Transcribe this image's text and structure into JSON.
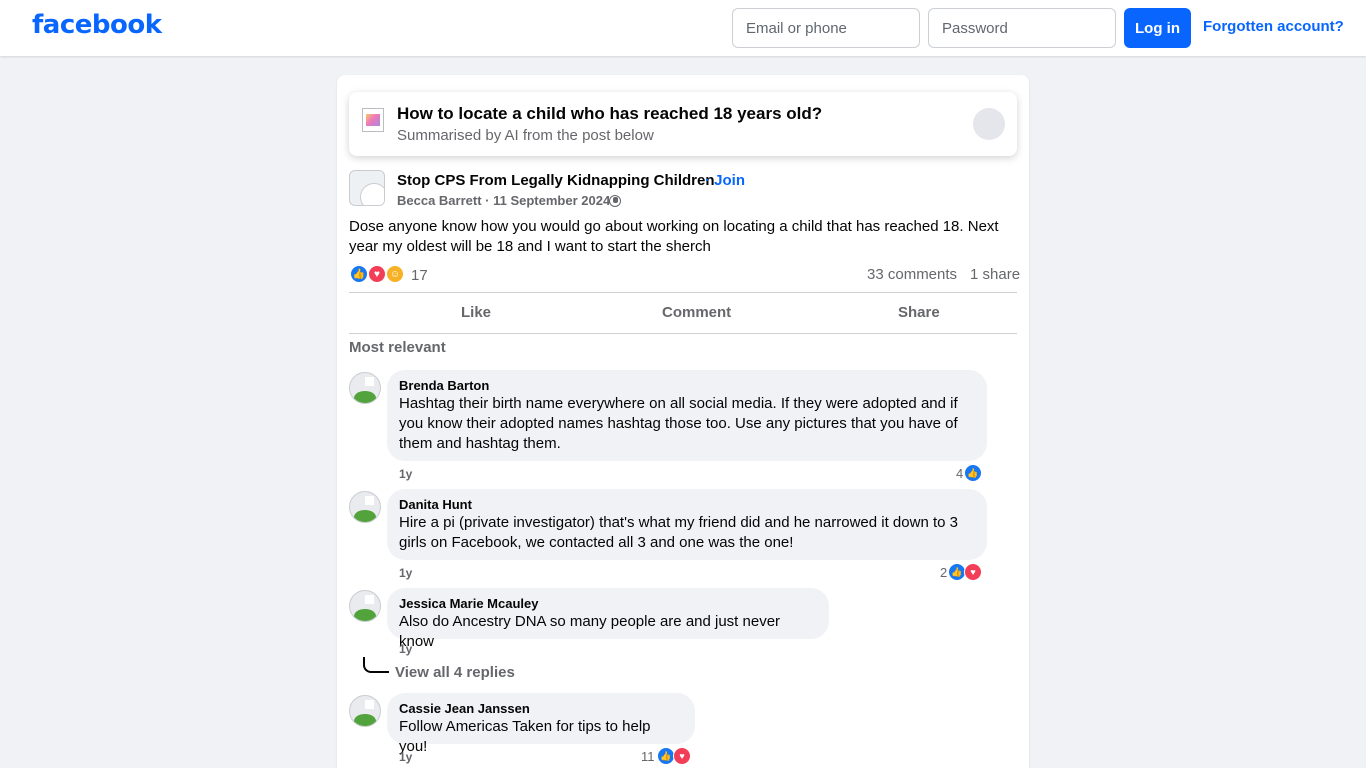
{
  "header": {
    "logo": "facebook",
    "email_placeholder": "Email or phone",
    "password_placeholder": "Password",
    "login_label": "Log in",
    "forgot_label": "Forgotten account?"
  },
  "ai_summary": {
    "title": "How to locate a child who has reached 18 years old?",
    "subtitle": "Summarised by AI from the post below"
  },
  "post": {
    "group_name": "Stop CPS From Legally Kidnapping Children",
    "join_label": "· Join",
    "author_date": "Becca Barrett · 11 September 2024 ·",
    "text": "Dose anyone know how you would go about working on locating a child that has reached 18. Next year my oldest will be 18 and I want to start the sherch",
    "reactions_count": "17",
    "comments_count": "33 comments",
    "shares_count": "1 share",
    "actions": {
      "like": "Like",
      "comment": "Comment",
      "share": "Share"
    },
    "sort_label": "Most relevant"
  },
  "comments": [
    {
      "name": "Brenda Barton",
      "text": "Hashtag their birth name everywhere on all social media. If they were adopted and if you know their adopted names hashtag those too. Use any pictures that you have of them and hashtag them.",
      "time": "1y",
      "reactions": "4"
    },
    {
      "name": "Danita Hunt",
      "text": "Hire a pi (private investigator) that's what my friend did and he narrowed it down to 3 girls on Facebook, we contacted all 3 and one was the one!",
      "time": "1y",
      "reactions": "2"
    },
    {
      "name": "Jessica Marie Mcauley",
      "text": "Also do Ancestry DNA so many people are and just never know",
      "time": "1y",
      "reactions": ""
    },
    {
      "name": "Cassie Jean Janssen",
      "text": "Follow Americas Taken for tips to help you!",
      "time": "1y",
      "reactions": "11"
    }
  ],
  "view_replies_label": "View all 4 replies",
  "colors": {
    "brand": "#0866ff",
    "like": "#1877f2",
    "love": "#f33e58",
    "care": "#f7b125"
  }
}
